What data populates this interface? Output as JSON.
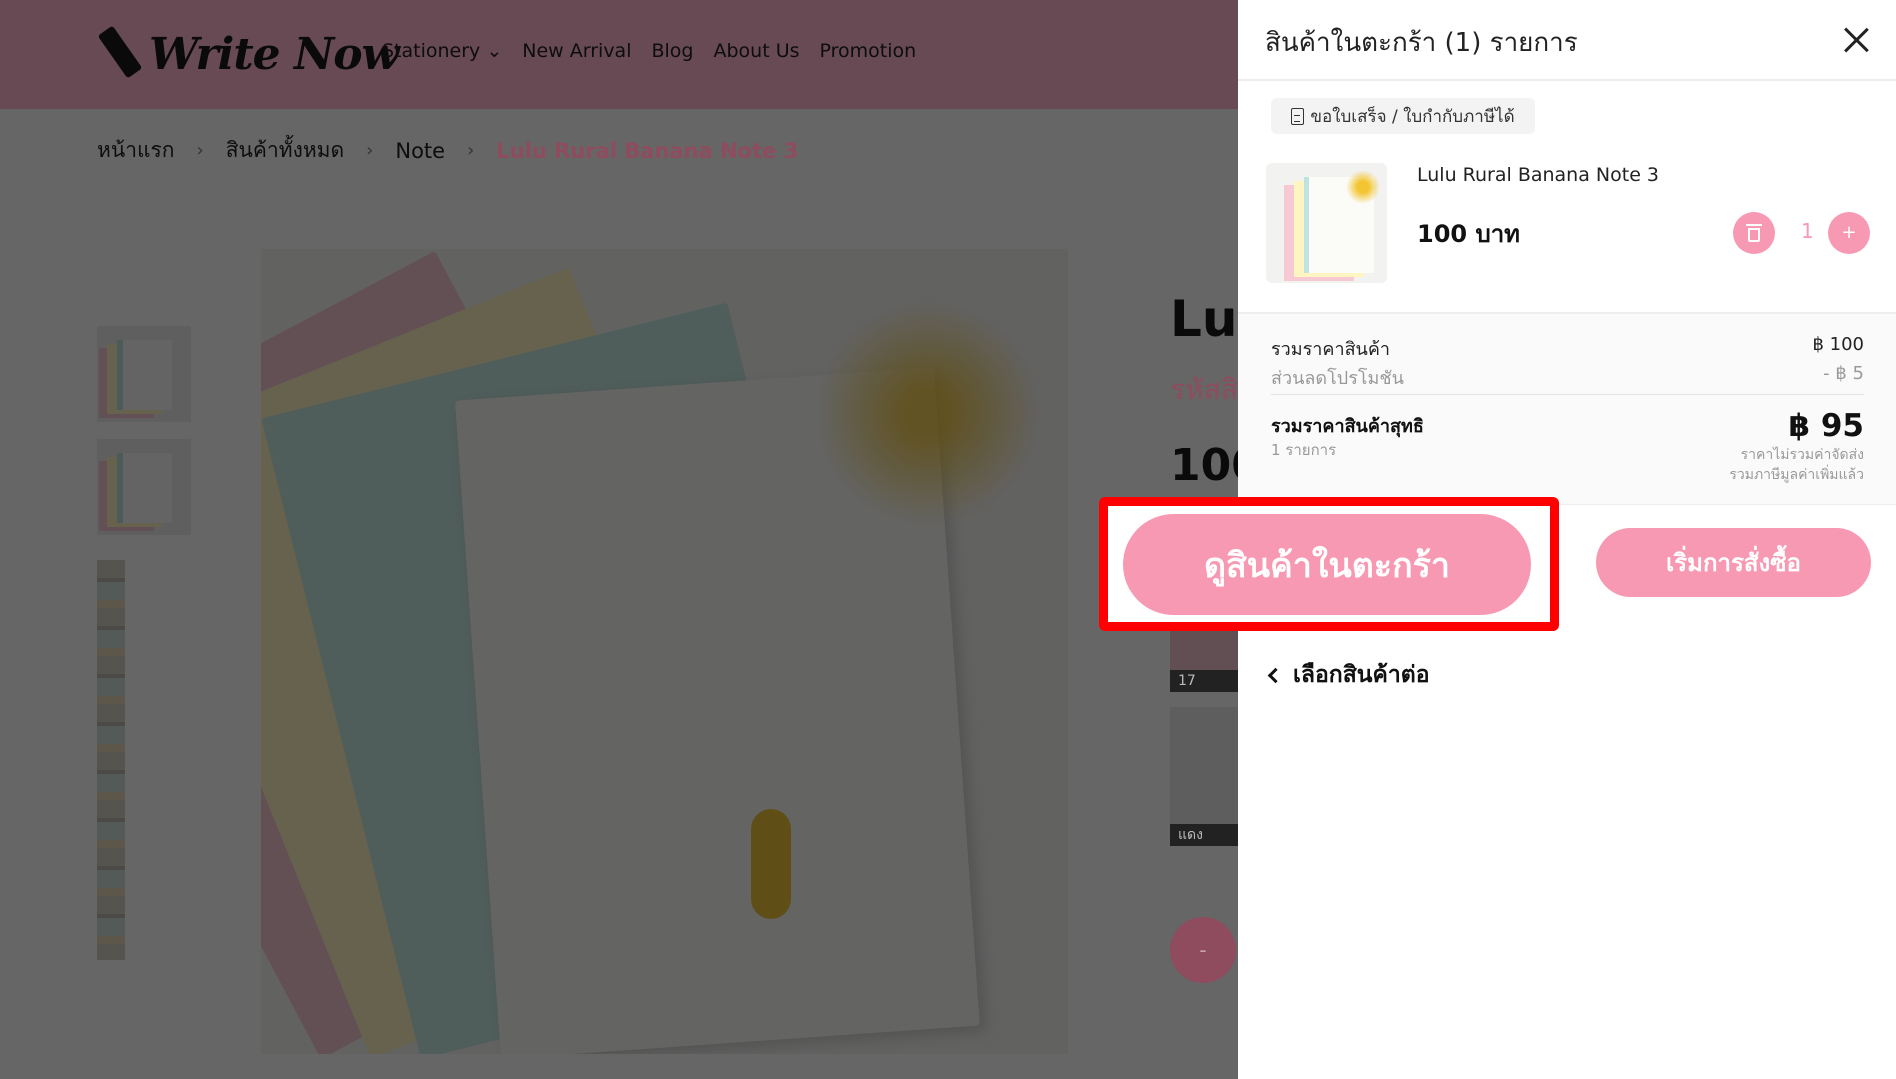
{
  "header": {
    "logo_text": "Write Now",
    "nav": [
      "Stationery",
      "New Arrival",
      "Blog",
      "About Us",
      "Promotion"
    ]
  },
  "breadcrumb": [
    "หน้าแรก",
    "สินค้าทั้งหมด",
    "Note",
    "Lulu Rural Banana Note 3"
  ],
  "product": {
    "title_partial": "Lul",
    "code_partial": "รหัสสิ",
    "price_partial": "100",
    "variant_labels": [
      "17",
      "แดง"
    ],
    "minus_label": "-"
  },
  "cart": {
    "title": "สินค้าในตะกร้า (1) รายการ",
    "receipt_button": "ขอใบเสร็จ / ใบกำกับภาษีได้",
    "item": {
      "name": "Lulu Rural Banana Note 3",
      "price": "100 บาท",
      "quantity": "1",
      "plus": "+"
    },
    "summary": {
      "subtotal_label": "รวมราคาสินค้า",
      "subtotal_value": "฿ 100",
      "discount_label": "ส่วนลดโปรโมชัน",
      "discount_value": "- ฿ 5",
      "net_label": "รวมราคาสินค้าสุทธิ",
      "net_count": "1 รายการ",
      "net_value": "฿ 95",
      "note_shipping": "ราคาไม่รวมค่าจัดส่ง",
      "note_vat": "รวมภาษีมูลค่าเพิ่มแล้ว"
    },
    "view_cart_button": "ดูสินค้าในตะกร้า",
    "checkout_button": "เริ่มการสั่งซื้อ",
    "continue_link": "เลือกสินค้าต่อ"
  },
  "colors": {
    "accent": "#f899b4",
    "highlight": "#ff0000",
    "overlay": "rgba(0,0,0,0.6)"
  }
}
